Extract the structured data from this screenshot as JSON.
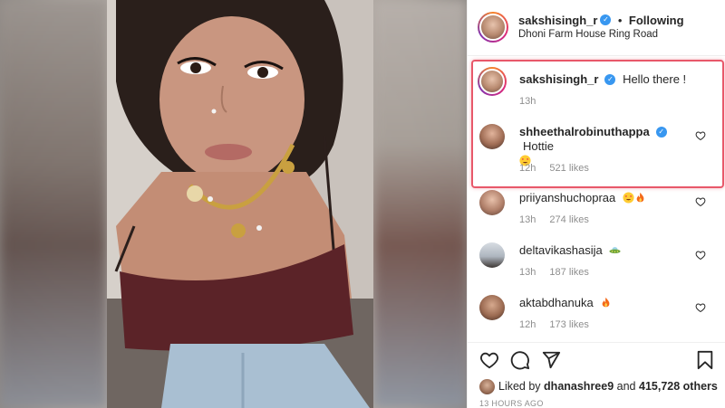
{
  "post": {
    "author": "sakshisingh_r",
    "follow_separator": "•",
    "follow_status": "Following",
    "location": "Dhoni Farm House Ring Road"
  },
  "comments": [
    {
      "username": "sakshisingh_r",
      "verified": true,
      "text": "Hello there !",
      "time": "13h",
      "likes": ""
    },
    {
      "username": "shheethalrobinuthappa",
      "verified": true,
      "text": "Hottie",
      "time": "12h",
      "likes": "521 likes",
      "emoji": [
        "heart-eyes"
      ]
    },
    {
      "username": "priiyanshuchopraa",
      "verified": false,
      "text": "",
      "time": "13h",
      "likes": "274 likes",
      "emoji": [
        "heart-eyes",
        "fire"
      ]
    },
    {
      "username": "deltavikashasija",
      "verified": false,
      "text": "",
      "time": "13h",
      "likes": "187 likes",
      "emoji": [
        "ufo"
      ]
    },
    {
      "username": "aktabdhanuka",
      "verified": false,
      "text": "",
      "time": "12h",
      "likes": "173 likes",
      "emoji": [
        "fire"
      ]
    }
  ],
  "likes_summary": {
    "prefix": "Liked by",
    "user": "dhanashree9",
    "joiner": "and",
    "others": "415,728 others"
  },
  "timestamp": "13 HOURS AGO",
  "icons": [
    "verified-badge-icon",
    "heart-icon",
    "comment-icon",
    "share-icon",
    "bookmark-icon"
  ],
  "colors": {
    "verified": "#3897f0",
    "highlight": "#e8586a",
    "muted": "#8e8e8e"
  }
}
